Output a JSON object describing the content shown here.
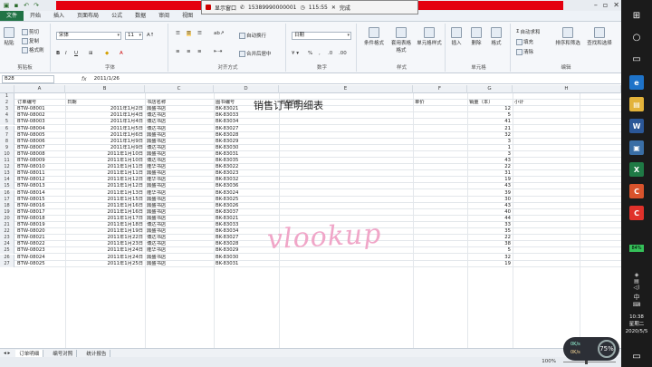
{
  "ribbon_tabs": [
    "文件",
    "开始",
    "插入",
    "页面布局",
    "公式",
    "数据",
    "审阅",
    "视图"
  ],
  "recorder": {
    "label": "显示窗口",
    "phone": "15389990000001",
    "time": "115:55",
    "stop": "完成"
  },
  "clipboard": {
    "paste": "粘贴",
    "cut": "剪切",
    "copy": "复制",
    "format_painter": "格式刷",
    "group": "剪贴板"
  },
  "font": {
    "name": "宋体",
    "size": "11",
    "group": "字体"
  },
  "alignment": {
    "wrap": "自动换行",
    "merge": "合并后居中",
    "group": "对齐方式"
  },
  "number": {
    "format": "日期",
    "group": "数字"
  },
  "styles": {
    "conditional": "条件格式",
    "table": "套用表格格式",
    "cell": "单元格样式",
    "group": "样式"
  },
  "cells": {
    "insert": "插入",
    "delete": "删除",
    "format": "格式",
    "group": "单元格"
  },
  "editing": {
    "autosum": "自动求和",
    "fill": "填充",
    "clear": "清除",
    "sort": "排序和筛选",
    "find": "查找和选择",
    "group": "编辑"
  },
  "formula_bar": {
    "cell_ref": "B28",
    "fx": "fx",
    "value": "2011/1/26"
  },
  "columns": [
    "A",
    "B",
    "C",
    "D",
    "E",
    "F",
    "G",
    "H"
  ],
  "sheet": {
    "title": "销售订单明细表",
    "headers": [
      "订单编号",
      "日期",
      "书店名称",
      "图书编号",
      "图书名称",
      "单价",
      "销量（本）",
      "小计"
    ],
    "rows": [
      [
        "BTW-08001",
        "2011年1月2日",
        "鼎盛书店",
        "BK-83021",
        "",
        "",
        "12",
        ""
      ],
      [
        "BTW-08002",
        "2011年1月4日",
        "博达书店",
        "BK-83033",
        "",
        "",
        "5",
        ""
      ],
      [
        "BTW-08003",
        "2011年1月4日",
        "博达书店",
        "BK-83034",
        "",
        "",
        "41",
        ""
      ],
      [
        "BTW-08004",
        "2011年1月5日",
        "博达书店",
        "BK-83027",
        "",
        "",
        "21",
        ""
      ],
      [
        "BTW-08005",
        "2011年1月6日",
        "鼎盛书店",
        "BK-83028",
        "",
        "",
        "32",
        ""
      ],
      [
        "BTW-08006",
        "2011年1月9日",
        "鼎盛书店",
        "BK-83029",
        "",
        "",
        "3",
        ""
      ],
      [
        "BTW-08007",
        "2011年1月9日",
        "博达书店",
        "BK-83030",
        "",
        "",
        "1",
        ""
      ],
      [
        "BTW-08008",
        "2011年1月10日",
        "鼎盛书店",
        "BK-83031",
        "",
        "",
        "3",
        ""
      ],
      [
        "BTW-08009",
        "2011年1月10日",
        "博达书店",
        "BK-83035",
        "",
        "",
        "43",
        ""
      ],
      [
        "BTW-08010",
        "2011年1月11日",
        "隆华书店",
        "BK-83022",
        "",
        "",
        "22",
        ""
      ],
      [
        "BTW-08011",
        "2011年1月11日",
        "鼎盛书店",
        "BK-83023",
        "",
        "",
        "31",
        ""
      ],
      [
        "BTW-08012",
        "2011年1月12日",
        "隆华书店",
        "BK-83032",
        "",
        "",
        "19",
        ""
      ],
      [
        "BTW-08013",
        "2011年1月12日",
        "鼎盛书店",
        "BK-83036",
        "",
        "",
        "43",
        ""
      ],
      [
        "BTW-08014",
        "2011年1月13日",
        "隆华书店",
        "BK-83024",
        "",
        "",
        "39",
        ""
      ],
      [
        "BTW-08015",
        "2011年1月15日",
        "鼎盛书店",
        "BK-83025",
        "",
        "",
        "30",
        ""
      ],
      [
        "BTW-08016",
        "2011年1月16日",
        "鼎盛书店",
        "BK-83026",
        "",
        "",
        "43",
        ""
      ],
      [
        "BTW-08017",
        "2011年1月16日",
        "鼎盛书店",
        "BK-83037",
        "",
        "",
        "40",
        ""
      ],
      [
        "BTW-08018",
        "2011年1月17日",
        "鼎盛书店",
        "BK-83021",
        "",
        "",
        "44",
        ""
      ],
      [
        "BTW-08019",
        "2011年1月18日",
        "博达书店",
        "BK-83033",
        "",
        "",
        "33",
        ""
      ],
      [
        "BTW-08020",
        "2011年1月19日",
        "鼎盛书店",
        "BK-83034",
        "",
        "",
        "35",
        ""
      ],
      [
        "BTW-08021",
        "2011年1月22日",
        "博达书店",
        "BK-83027",
        "",
        "",
        "22",
        ""
      ],
      [
        "BTW-08022",
        "2011年1月23日",
        "博达书店",
        "BK-83028",
        "",
        "",
        "38",
        ""
      ],
      [
        "BTW-08023",
        "2011年1月24日",
        "隆华书店",
        "BK-83029",
        "",
        "",
        "5",
        ""
      ],
      [
        "BTW-08024",
        "2011年1月24日",
        "鼎盛书店",
        "BK-83030",
        "",
        "",
        "32",
        ""
      ],
      [
        "BTW-08025",
        "2011年1月25日",
        "鼎盛书店",
        "BK-83031",
        "",
        "",
        "19",
        ""
      ]
    ]
  },
  "watermark": "vlookup",
  "sheet_tabs": [
    "订单明细",
    "编号对照",
    "统计报告"
  ],
  "status": {
    "zoom": "100%"
  },
  "speed_widget": {
    "up": "0K/s",
    "down": "0K/s",
    "percent": "75%"
  },
  "taskbar": {
    "battery": "84%",
    "ime": "中",
    "time": "10:38",
    "weekday": "星期二",
    "date": "2020/5/5"
  },
  "colors": {
    "excel_green": "#217346",
    "record_red": "#e4000f",
    "watermark_pink": "#f0a6c8"
  }
}
